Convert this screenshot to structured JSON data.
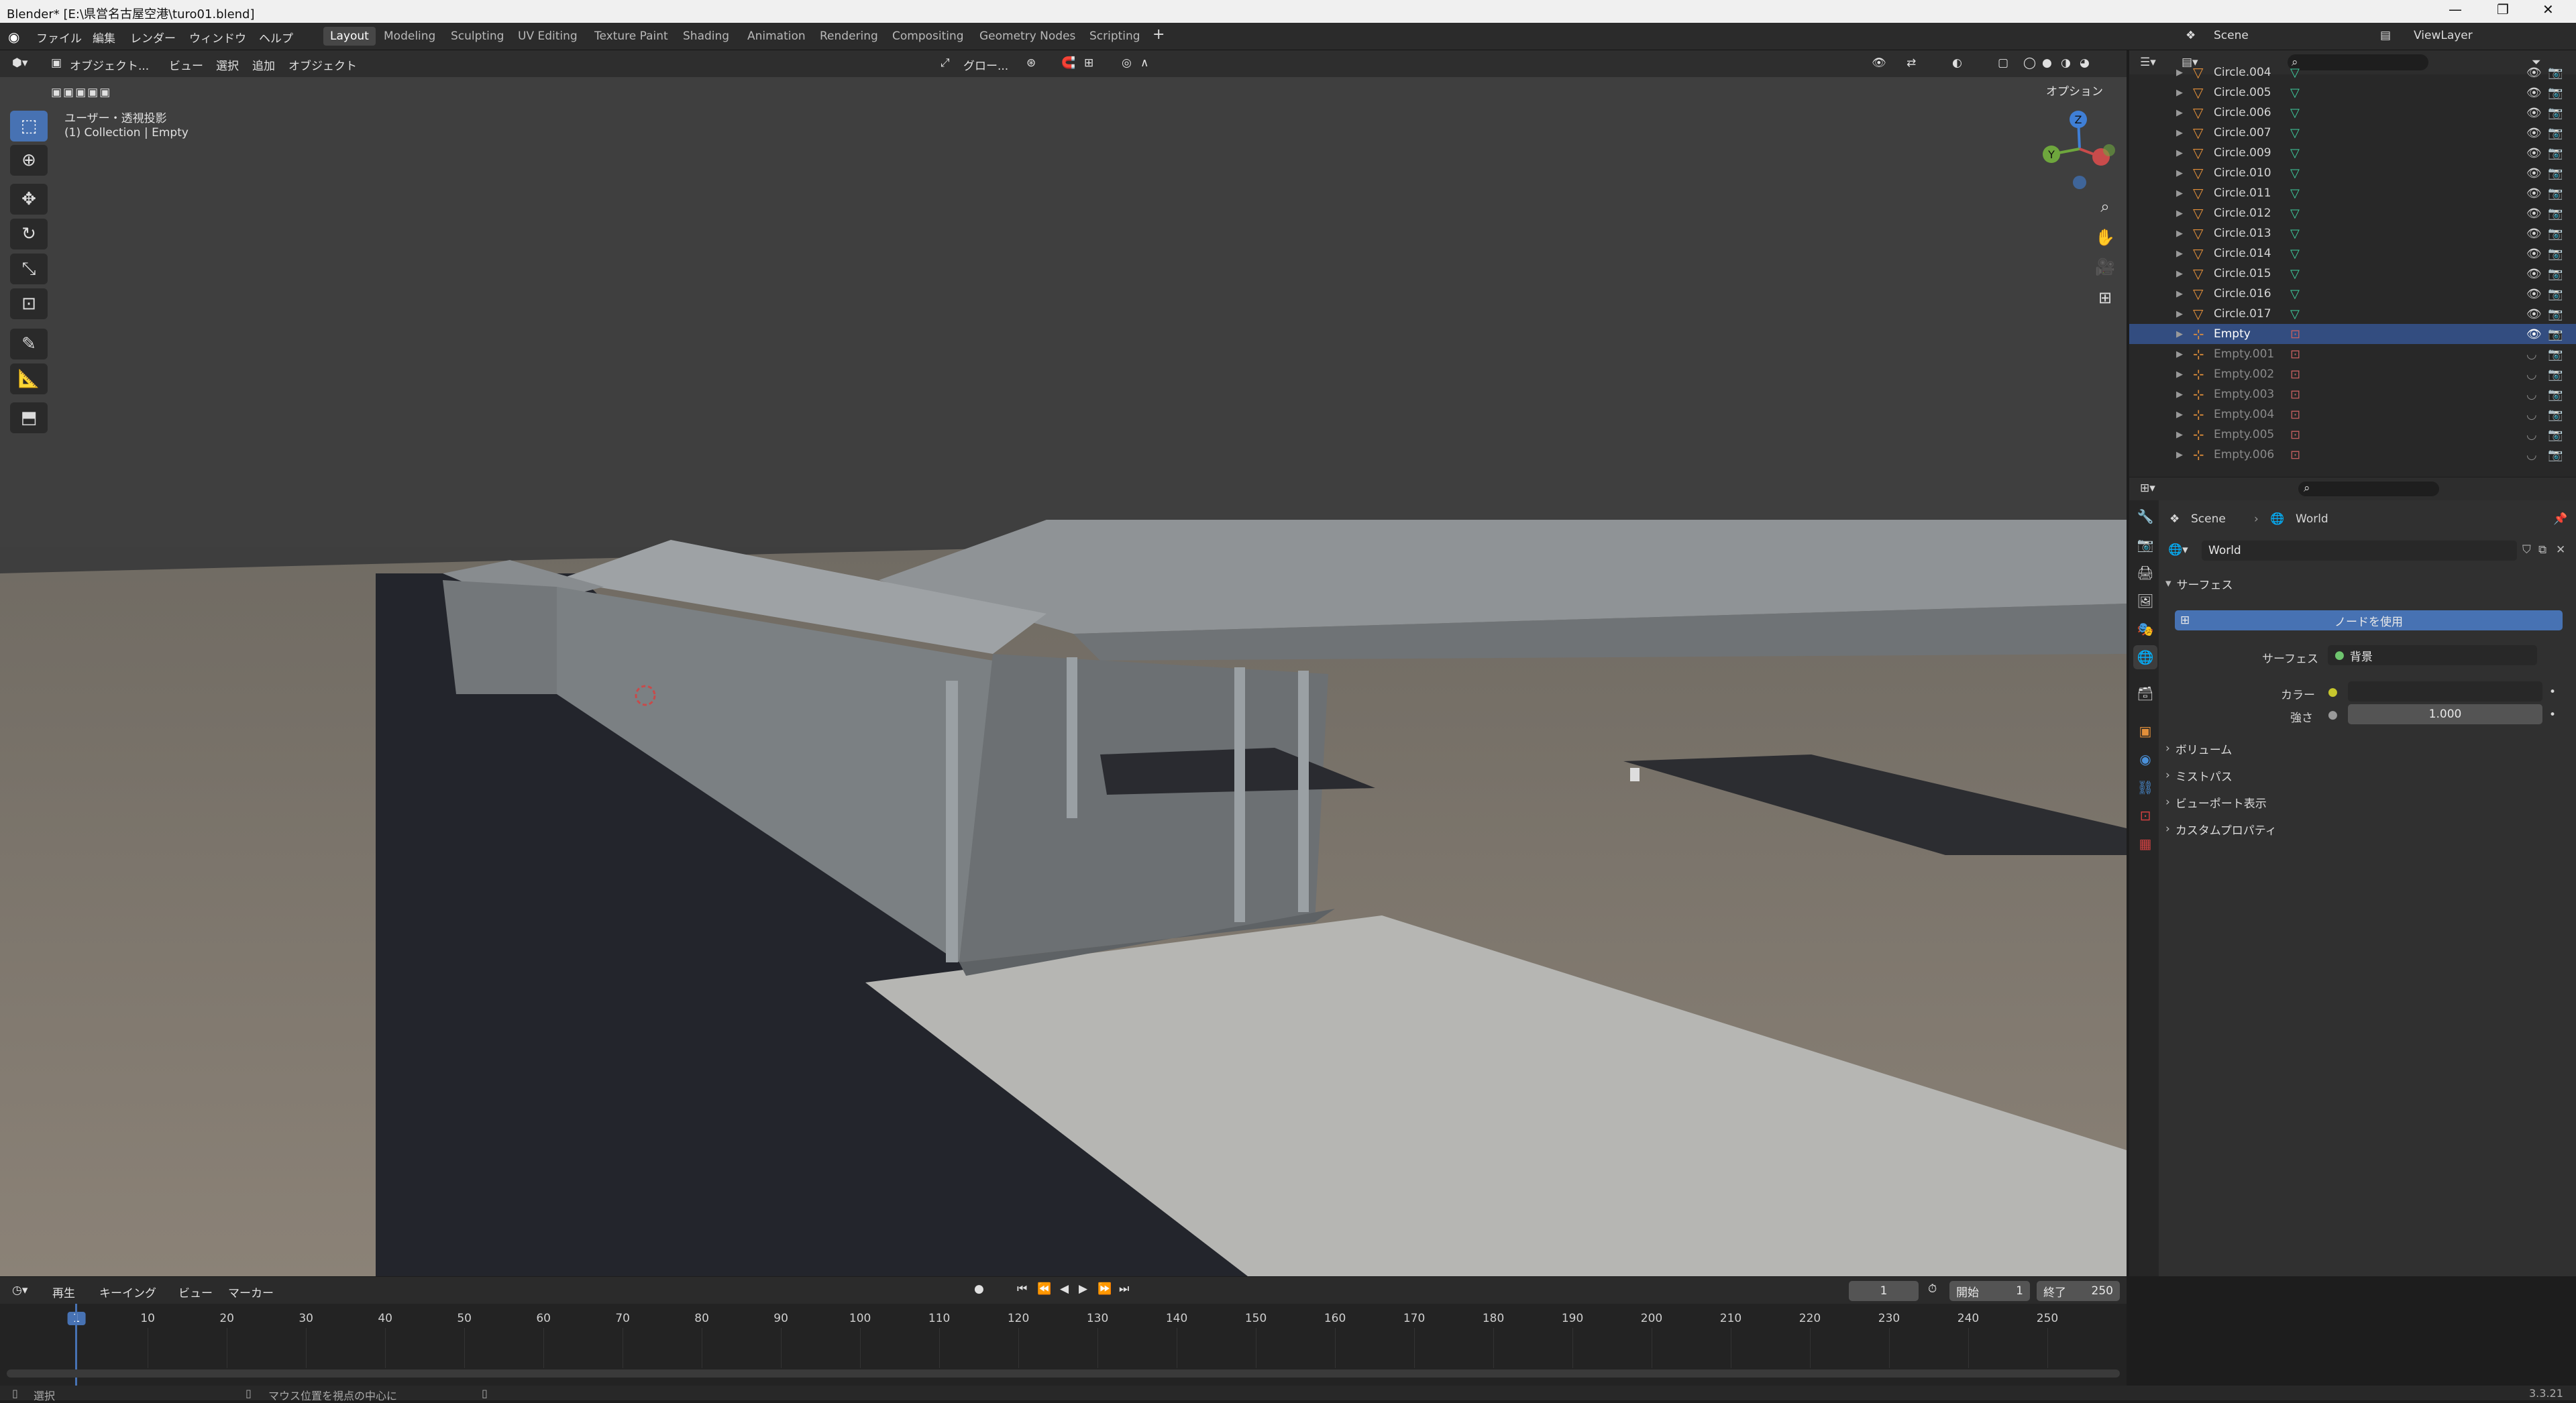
{
  "window": {
    "title": "Blender* [E:\\県営名古屋空港\\turo01.blend]"
  },
  "menu": [
    "ファイル",
    "編集",
    "レンダー",
    "ウィンドウ",
    "ヘルプ"
  ],
  "workspaces": [
    "Layout",
    "Modeling",
    "Sculpting",
    "UV Editing",
    "Texture Paint",
    "Shading",
    "Animation",
    "Rendering",
    "Compositing",
    "Geometry Nodes",
    "Scripting"
  ],
  "active_workspace": "Layout",
  "scene": {
    "name": "Scene",
    "view_layer": "ViewLayer"
  },
  "viewport": {
    "mode": "オブジェクト...",
    "menus": [
      "ビュー",
      "選択",
      "追加",
      "オブジェクト"
    ],
    "transform_orientation": "グロー...",
    "options_label": "オプション",
    "view_name": "ユーザー・透視投影",
    "collection_info": "(1) Collection | Empty",
    "gizmo_axes": {
      "z": "Z",
      "y": "Y"
    },
    "colors": {
      "background": "#3e3e3e",
      "x_axis": "#c94b4b",
      "y_axis": "#6ea63d",
      "z_axis": "#3f7fd6",
      "select": "#4772b3"
    }
  },
  "outliner": {
    "items": [
      {
        "name": "Circle.004",
        "selected": false,
        "dim": false
      },
      {
        "name": "Circle.005",
        "selected": false,
        "dim": false
      },
      {
        "name": "Circle.006",
        "selected": false,
        "dim": false
      },
      {
        "name": "Circle.007",
        "selected": false,
        "dim": false
      },
      {
        "name": "Circle.009",
        "selected": false,
        "dim": false
      },
      {
        "name": "Circle.010",
        "selected": false,
        "dim": false
      },
      {
        "name": "Circle.011",
        "selected": false,
        "dim": false
      },
      {
        "name": "Circle.012",
        "selected": false,
        "dim": false
      },
      {
        "name": "Circle.013",
        "selected": false,
        "dim": false
      },
      {
        "name": "Circle.014",
        "selected": false,
        "dim": false
      },
      {
        "name": "Circle.015",
        "selected": false,
        "dim": false
      },
      {
        "name": "Circle.016",
        "selected": false,
        "dim": false
      },
      {
        "name": "Circle.017",
        "selected": false,
        "dim": false
      },
      {
        "name": "Empty",
        "selected": true,
        "dim": false
      },
      {
        "name": "Empty.001",
        "selected": false,
        "dim": true
      },
      {
        "name": "Empty.002",
        "selected": false,
        "dim": true
      },
      {
        "name": "Empty.003",
        "selected": false,
        "dim": true
      },
      {
        "name": "Empty.004",
        "selected": false,
        "dim": true
      },
      {
        "name": "Empty.005",
        "selected": false,
        "dim": true
      },
      {
        "name": "Empty.006",
        "selected": false,
        "dim": true
      }
    ]
  },
  "properties": {
    "breadcrumb": [
      "Scene",
      "World"
    ],
    "world_name": "World",
    "surface_panel": "サーフェス",
    "use_nodes_button": "ノードを使用",
    "surface_label": "サーフェス",
    "surface_value": "背景",
    "color_label": "カラー",
    "strength_label": "強さ",
    "strength_value": "1.000",
    "collapsed_panels": [
      "ボリューム",
      "ミストパス",
      "ビューポート表示",
      "カスタムプロパティ"
    ]
  },
  "timeline": {
    "menus": [
      "再生",
      "キーイング",
      "ビュー",
      "マーカー"
    ],
    "current_frame": "1",
    "start_label": "開始",
    "start_frame": "1",
    "end_label": "終了",
    "end_frame": "250",
    "ticks": [
      "1",
      "10",
      "20",
      "30",
      "40",
      "50",
      "60",
      "70",
      "80",
      "90",
      "100",
      "110",
      "120",
      "130",
      "140",
      "150",
      "160",
      "170",
      "180",
      "190",
      "200",
      "210",
      "220",
      "230",
      "240",
      "250"
    ]
  },
  "status": {
    "select": "選択",
    "hint": "マウス位置を視点の中心に",
    "version": "3.3.21"
  }
}
